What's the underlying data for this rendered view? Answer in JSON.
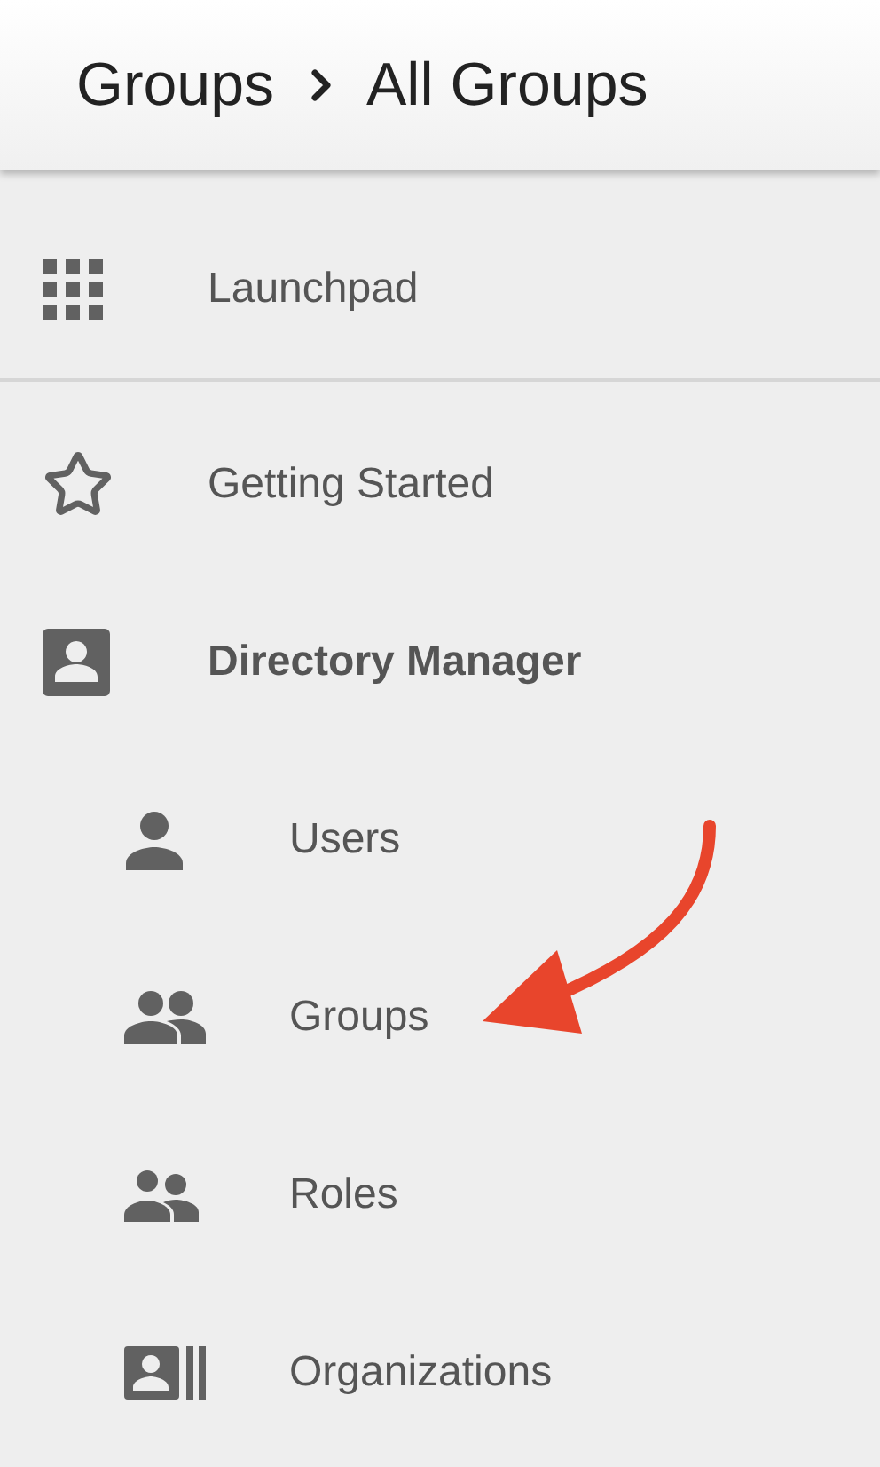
{
  "header": {
    "breadcrumb": [
      {
        "label": "Groups"
      },
      {
        "label": "All Groups"
      }
    ]
  },
  "launchpad": {
    "label": "Launchpad",
    "kind": "grid"
  },
  "items": [
    {
      "label": "Getting Started",
      "kind": "star",
      "expanded": false
    },
    {
      "label": "Directory Manager",
      "kind": "contact",
      "expanded": true,
      "children": [
        {
          "label": "Users",
          "kind": "person"
        },
        {
          "label": "Groups",
          "kind": "people"
        },
        {
          "label": "Roles",
          "kind": "roles"
        },
        {
          "label": "Organizations",
          "kind": "card"
        }
      ]
    }
  ]
}
